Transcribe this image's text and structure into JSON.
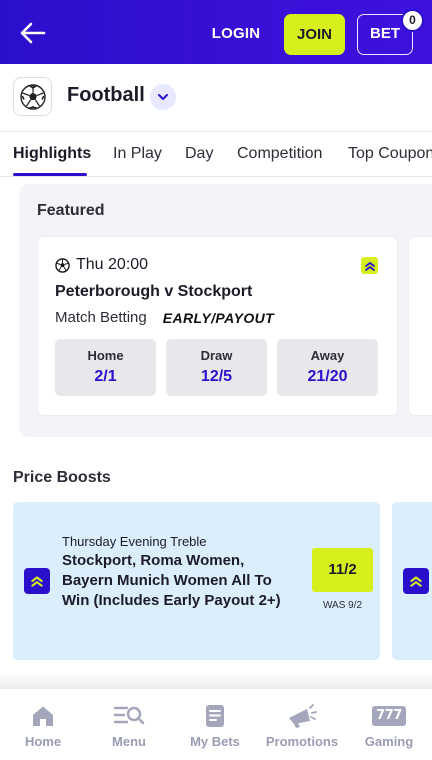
{
  "header": {
    "login_label": "LOGIN",
    "join_label": "JOIN",
    "bet_label": "BET",
    "bet_count": "0",
    "icons": {
      "back": "arrow-left-icon"
    }
  },
  "sport": {
    "title": "Football",
    "icon": "football-icon"
  },
  "tabs": [
    {
      "label": "Highlights",
      "active": true
    },
    {
      "label": "In Play",
      "active": false
    },
    {
      "label": "Day",
      "active": false
    },
    {
      "label": "Competition",
      "active": false
    },
    {
      "label": "Top Coupons",
      "active": false
    }
  ],
  "featured": {
    "title": "Featured",
    "match": {
      "time": "Thu 20:00",
      "teams": "Peterborough v Stockport",
      "market": "Match Betting",
      "promo": "EARLY/PAYOUT",
      "odds": [
        {
          "label": "Home",
          "price": "2/1"
        },
        {
          "label": "Draw",
          "price": "12/5"
        },
        {
          "label": "Away",
          "price": "21/20"
        }
      ]
    }
  },
  "price_boosts": {
    "title": "Price Boosts",
    "card": {
      "subtitle": "Thursday Evening Treble",
      "description": "Stockport, Roma Women, Bayern Munich Women All To Win (Includes Early Payout 2+)",
      "price": "11/2",
      "was": "WAS 9/2"
    }
  },
  "bottom_nav": [
    {
      "label": "Home",
      "icon": "home-icon",
      "active": false
    },
    {
      "label": "Menu",
      "icon": "menu-search-icon",
      "active": false
    },
    {
      "label": "My Bets",
      "icon": "betslip-icon",
      "active": false
    },
    {
      "label": "Promotions",
      "icon": "megaphone-icon",
      "active": false
    },
    {
      "label": "Gaming",
      "icon": "slots-777-icon",
      "active": false,
      "badge_text": "777"
    }
  ],
  "colors": {
    "brand_blue": "#2a10cc",
    "accent_yellow": "#d6ee1c",
    "boost_bg": "#dbeefc",
    "nav_grey": "#9a9cb2"
  }
}
